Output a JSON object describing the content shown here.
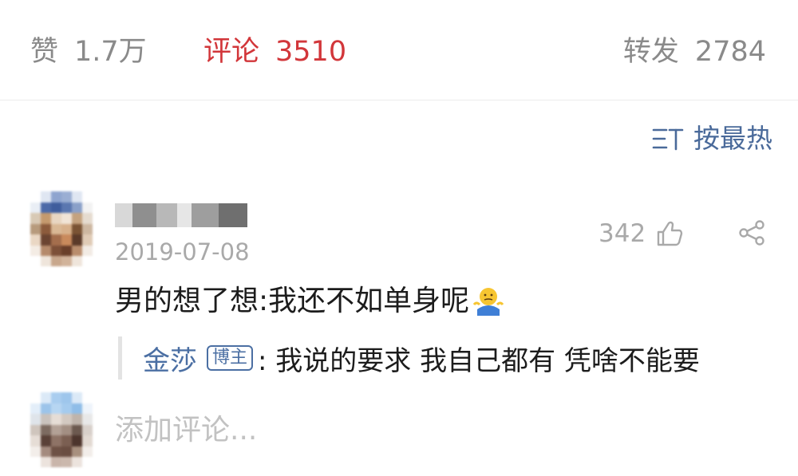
{
  "stats": {
    "likes": {
      "label": "赞",
      "count": "1.7万"
    },
    "comments": {
      "label": "评论",
      "count": "3510"
    },
    "reposts": {
      "label": "转发",
      "count": "2784"
    }
  },
  "sort": {
    "icon": "sort-icon",
    "label": "按最热"
  },
  "comment": {
    "date": "2019-07-08",
    "like_count": "342",
    "text": "男的想了想:我还不如单身呢",
    "emoji": "shrug-emoji",
    "reply": {
      "author": "金莎",
      "badge": "博主",
      "text": ": 我说的要求 我自己都有 凭啥不能要"
    }
  },
  "composer": {
    "placeholder": "添加评论..."
  },
  "colors": {
    "accent_red": "#d2363a",
    "link_blue": "#4b6fa3",
    "muted_gray": "#a9a9a9"
  }
}
